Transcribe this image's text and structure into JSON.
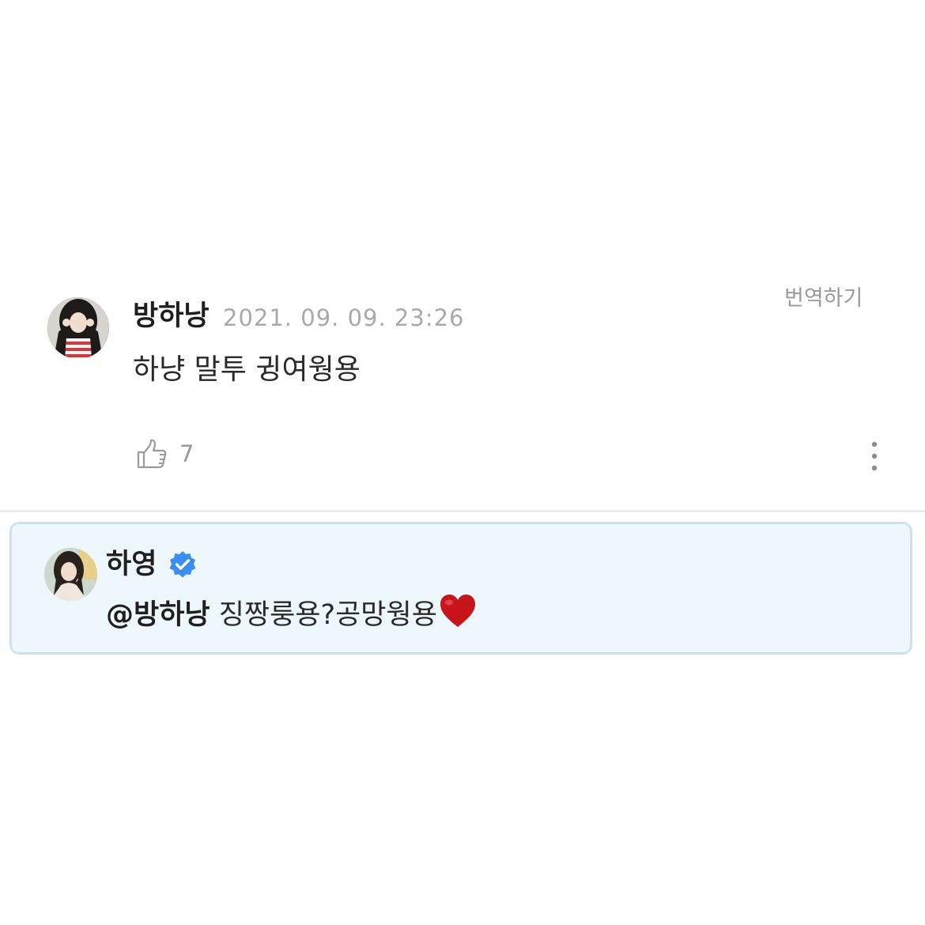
{
  "comment": {
    "author": "방하낭",
    "timestamp": "2021. 09. 09. 23:26",
    "translate_label": "번역하기",
    "text": "하냥 말투 귕여웡용",
    "like_count": "7",
    "avatar_icon": "profile-photo"
  },
  "reply": {
    "author": "하영",
    "verified": true,
    "mention": "@방하낭",
    "text": " 징짱룽용?공망웡용",
    "emoji": "heart",
    "colors": {
      "background": "#eef8fc",
      "border": "#cfe3ea",
      "verified_badge": "#3b8ef0",
      "heart": "#c8151b"
    }
  }
}
